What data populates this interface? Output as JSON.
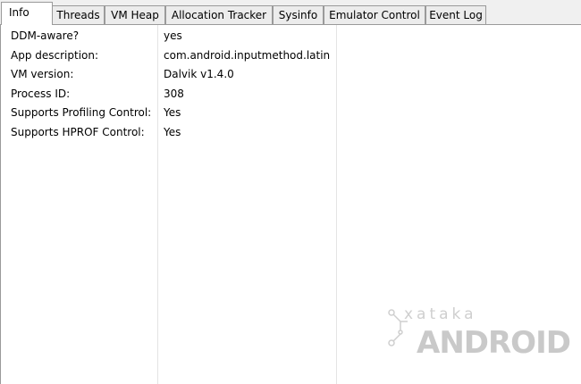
{
  "tabs": [
    {
      "label": "Info",
      "active": true
    },
    {
      "label": "Threads",
      "active": false
    },
    {
      "label": "VM Heap",
      "active": false
    },
    {
      "label": "Allocation Tracker",
      "active": false
    },
    {
      "label": "Sysinfo",
      "active": false
    },
    {
      "label": "Emulator Control",
      "active": false
    },
    {
      "label": "Event Log",
      "active": false
    }
  ],
  "info": {
    "rows": [
      {
        "name": "DDM-aware?",
        "value": "yes"
      },
      {
        "name": "App description:",
        "value": "com.android.inputmethod.latin"
      },
      {
        "name": "VM version:",
        "value": "Dalvik v1.4.0"
      },
      {
        "name": "Process ID:",
        "value": "308"
      },
      {
        "name": "Supports Profiling Control:",
        "value": "Yes"
      },
      {
        "name": "Supports HPROF Control:",
        "value": "Yes"
      }
    ]
  },
  "watermark": {
    "line1": "xataka",
    "line2": "ANDROID"
  }
}
